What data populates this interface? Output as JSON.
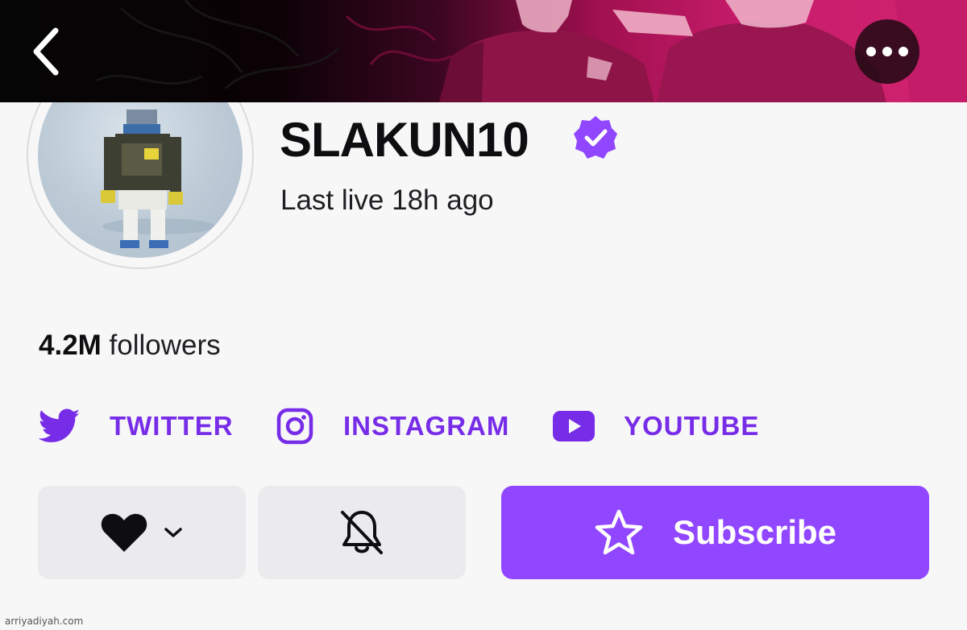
{
  "header": {
    "back_icon": "chevron-left-icon",
    "more_icon": "more-horizontal-icon",
    "banner_colors": [
      "#050505",
      "#a0104f",
      "#d0236f"
    ]
  },
  "channel": {
    "name": "SLAKUN10",
    "verified": true,
    "verified_color": "#9147ff",
    "last_live": "Last live 18h ago",
    "followers_count": "4.2M",
    "followers_label": " followers"
  },
  "social_links": [
    {
      "label": "TWITTER",
      "icon": "twitter-icon"
    },
    {
      "label": "INSTAGRAM",
      "icon": "instagram-icon"
    },
    {
      "label": "YOUTUBE",
      "icon": "youtube-icon"
    }
  ],
  "actions": {
    "follow_icon": "heart-icon",
    "follow_dropdown_icon": "chevron-down-icon",
    "notifications_icon": "bell-off-icon",
    "subscribe_label": "Subscribe",
    "subscribe_icon": "star-icon"
  },
  "colors": {
    "accent": "#9147ff",
    "link": "#772ce8",
    "button_bg": "#ebebee",
    "page_bg": "#f7f7f8"
  },
  "watermark": "arriyadiyah.com"
}
